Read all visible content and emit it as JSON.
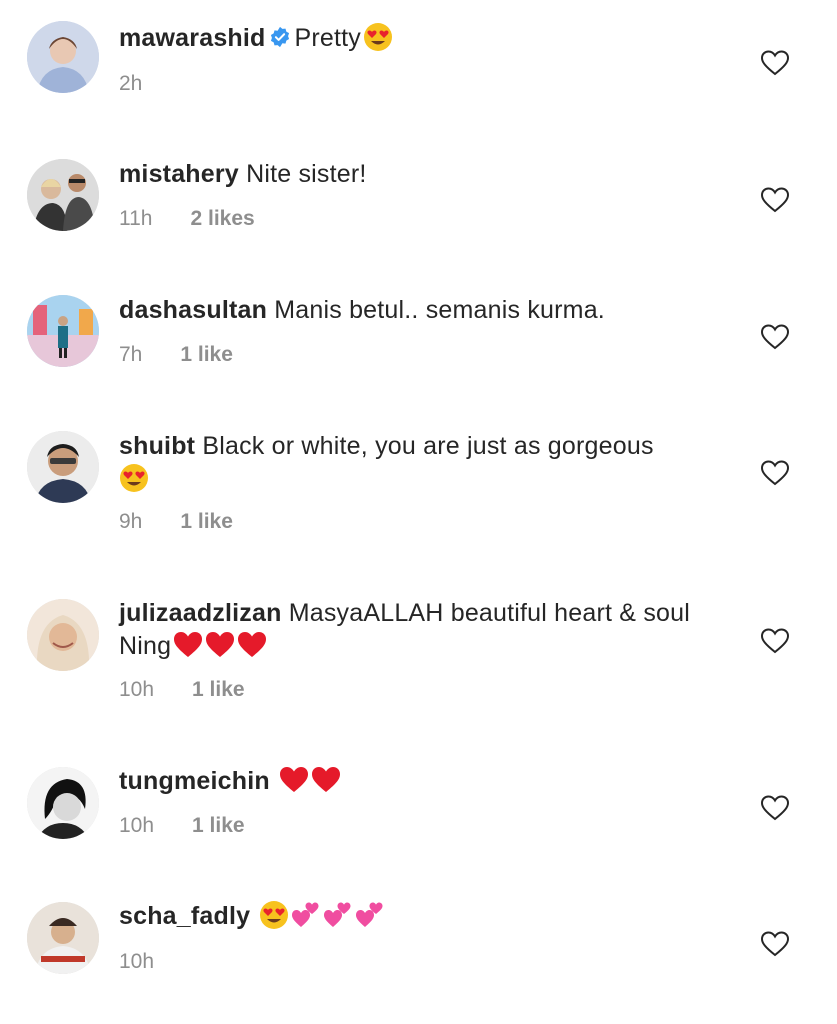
{
  "comments": [
    {
      "username": "mawarashid",
      "verified": true,
      "text": "Pretty",
      "emoji": [
        "heart-eyes"
      ],
      "time": "2h",
      "likes": ""
    },
    {
      "username": "mistahery",
      "verified": false,
      "text": "Nite sister!",
      "emoji": [],
      "time": "11h",
      "likes": "2 likes"
    },
    {
      "username": "dashasultan",
      "verified": false,
      "text": "Manis betul.. semanis kurma.",
      "emoji": [],
      "time": "7h",
      "likes": "1 like"
    },
    {
      "username": "shuibt",
      "verified": false,
      "text": "Black or white, you are just as gorgeous",
      "emoji": [
        "heart-eyes"
      ],
      "time": "9h",
      "likes": "1 like"
    },
    {
      "username": "julizaadzlizan",
      "verified": false,
      "text": "MasyaALLAH beautiful heart & soul Ning",
      "emoji": [
        "red-heart",
        "red-heart",
        "red-heart"
      ],
      "time": "10h",
      "likes": "1 like"
    },
    {
      "username": "tungmeichin",
      "verified": false,
      "text": "",
      "emoji": [
        "red-heart",
        "red-heart"
      ],
      "time": "10h",
      "likes": "1 like"
    },
    {
      "username": "scha_fadly",
      "verified": false,
      "text": "",
      "emoji": [
        "heart-eyes",
        "two-hearts",
        "two-hearts",
        "two-hearts"
      ],
      "time": "10h",
      "likes": ""
    }
  ],
  "colors": {
    "text": "#262626",
    "meta": "#8e8e8e",
    "verified": "#3897f0",
    "heart": "#262626"
  }
}
